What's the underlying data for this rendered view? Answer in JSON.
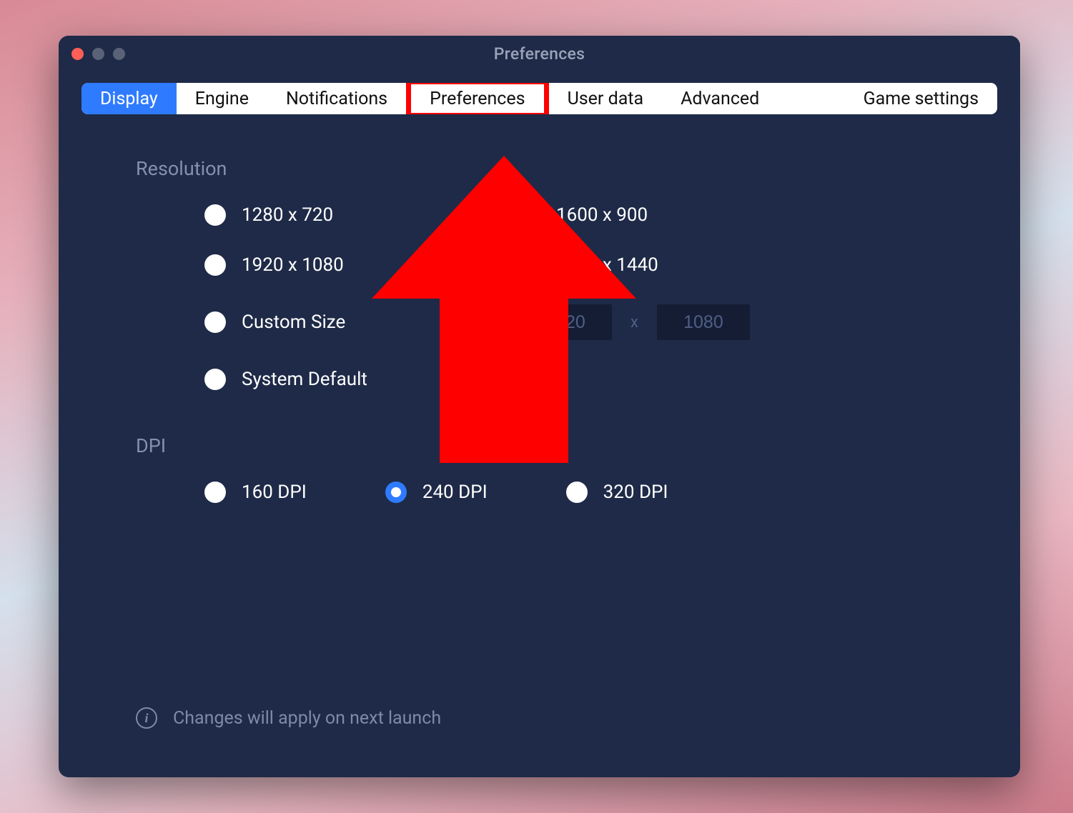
{
  "window": {
    "title": "Preferences"
  },
  "tabs": {
    "display": "Display",
    "engine": "Engine",
    "notifications": "Notifications",
    "preferences": "Preferences",
    "user_data": "User data",
    "advanced": "Advanced",
    "game_settings": "Game settings"
  },
  "sections": {
    "resolution_label": "Resolution",
    "dpi_label": "DPI"
  },
  "resolution": {
    "r1280x720": "1280 x 720",
    "r1600x900": "1600 x 900",
    "r1920x1080": "1920 x 1080",
    "r2560x1440": "2560 x 1440",
    "custom": "Custom Size",
    "custom_w": "1920",
    "custom_h": "1080",
    "custom_sep": "x",
    "system_default": "System Default"
  },
  "dpi": {
    "d160": "160 DPI",
    "d240": "240 DPI",
    "d320": "320 DPI"
  },
  "footer": {
    "note": "Changes will apply on next launch"
  }
}
